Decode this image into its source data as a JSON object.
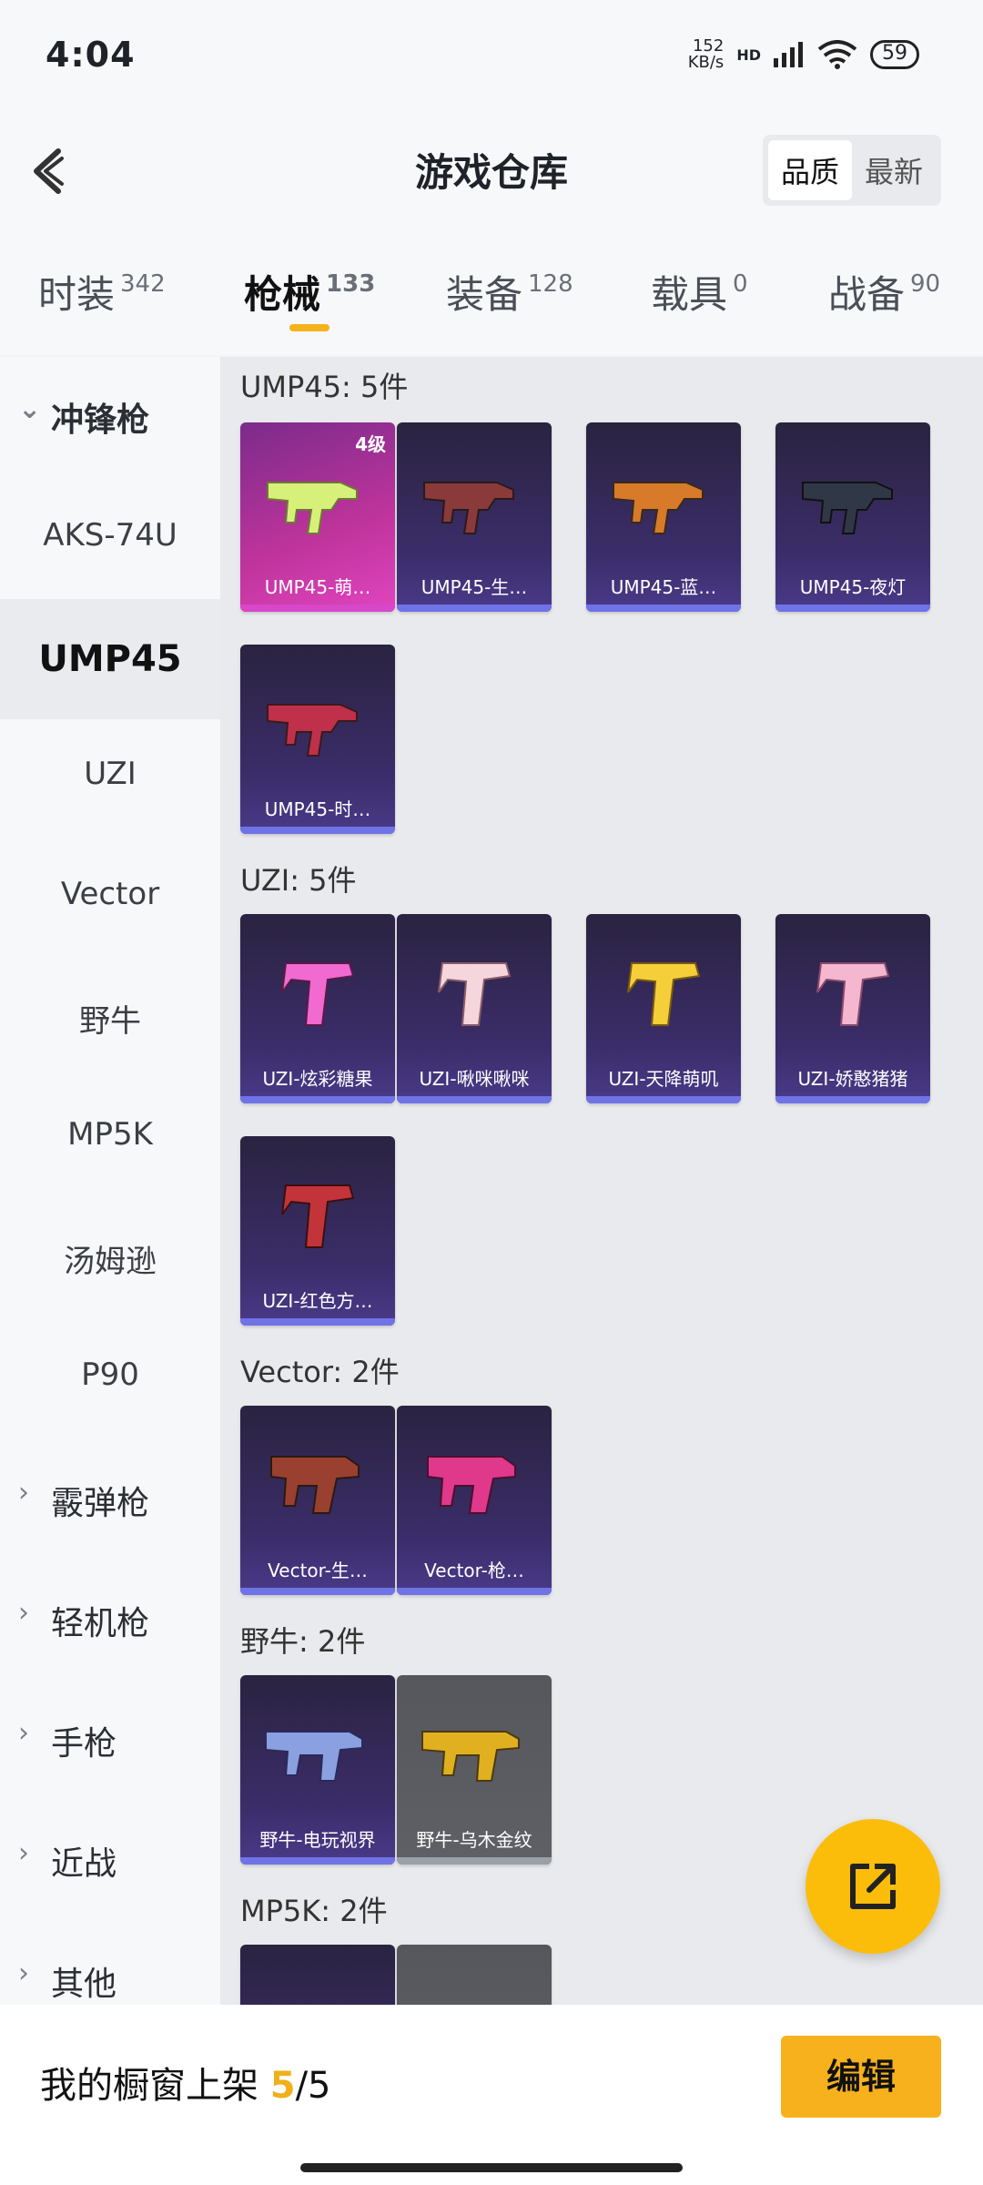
{
  "status_bar": {
    "time": "4:04",
    "net_speed_value": "152",
    "net_speed_unit": "KB/s",
    "network_type": "HD",
    "battery": "59"
  },
  "header": {
    "title": "游戏仓库",
    "sort_quality": "品质",
    "sort_newest": "最新"
  },
  "tabs": [
    {
      "label": "时装",
      "count": "342"
    },
    {
      "label": "枪械",
      "count": "133"
    },
    {
      "label": "装备",
      "count": "128"
    },
    {
      "label": "载具",
      "count": "0"
    },
    {
      "label": "战备",
      "count": "90"
    }
  ],
  "sidebar": {
    "group_smg": "冲锋枪",
    "items": [
      "AKS-74U",
      "UMP45",
      "UZI",
      "Vector",
      "野牛",
      "MP5K",
      "汤姆逊",
      "P90"
    ],
    "groups": [
      "霰弹枪",
      "轻机枪",
      "手枪",
      "近战",
      "其他"
    ]
  },
  "sections": {
    "ump45": {
      "title": "UMP45: 5件",
      "items": [
        {
          "name": "UMP45-萌…",
          "grade": "4级"
        },
        {
          "name": "UMP45-生…"
        },
        {
          "name": "UMP45-蓝…"
        },
        {
          "name": "UMP45-夜灯"
        },
        {
          "name": "UMP45-时…"
        }
      ]
    },
    "uzi": {
      "title": "UZI: 5件",
      "items": [
        {
          "name": "UZI-炫彩糖果"
        },
        {
          "name": "UZI-啾咪啾咪"
        },
        {
          "name": "UZI-天降萌叽"
        },
        {
          "name": "UZI-娇憨猪猪"
        },
        {
          "name": "UZI-红色方…"
        }
      ]
    },
    "vector": {
      "title": "Vector: 2件",
      "items": [
        {
          "name": "Vector-生…"
        },
        {
          "name": "Vector-枪…"
        }
      ]
    },
    "bizon": {
      "title": "野牛: 2件",
      "items": [
        {
          "name": "野牛-电玩视界"
        },
        {
          "name": "野牛-乌木金纹"
        }
      ]
    },
    "mp5k": {
      "title": "MP5K: 2件"
    }
  },
  "bottom_bar": {
    "label": "我的橱窗上架",
    "current": "5",
    "total": "/5",
    "edit_button": "编辑"
  }
}
